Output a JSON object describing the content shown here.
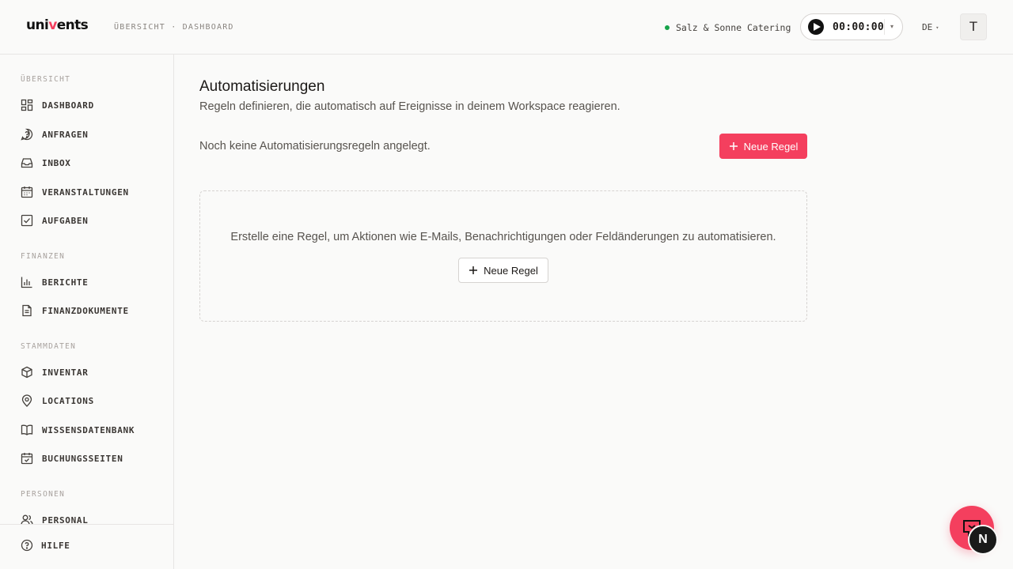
{
  "header": {
    "logo_prefix": "uni",
    "logo_accent": "v",
    "logo_suffix": "ents",
    "breadcrumb": "ÜBERSICHT · DASHBOARD",
    "workspace_name": "Salz & Sonne Catering",
    "timer": "00:00:00",
    "language": "DE",
    "avatar_initial": "T"
  },
  "sidebar": {
    "sections": [
      {
        "label": "ÜBERSICHT",
        "items": [
          {
            "label": "DASHBOARD",
            "icon": "dashboard-icon"
          },
          {
            "label": "ANFRAGEN",
            "icon": "question-icon"
          },
          {
            "label": "INBOX",
            "icon": "inbox-icon"
          },
          {
            "label": "VERANSTALTUNGEN",
            "icon": "calendar-icon"
          },
          {
            "label": "AUFGABEN",
            "icon": "checkbox-icon"
          }
        ]
      },
      {
        "label": "FINANZEN",
        "items": [
          {
            "label": "BERICHTE",
            "icon": "bar-chart-icon"
          },
          {
            "label": "FINANZDOKUMENTE",
            "icon": "document-icon"
          }
        ]
      },
      {
        "label": "STAMMDATEN",
        "items": [
          {
            "label": "INVENTAR",
            "icon": "box-icon"
          },
          {
            "label": "LOCATIONS",
            "icon": "map-pin-icon"
          },
          {
            "label": "WISSENSDATENBANK",
            "icon": "book-icon"
          },
          {
            "label": "BUCHUNGSSEITEN",
            "icon": "calendar-check-icon"
          }
        ]
      },
      {
        "label": "PERSONEN",
        "items": [
          {
            "label": "PERSONAL",
            "icon": "users-icon"
          }
        ]
      }
    ],
    "help_label": "HILFE"
  },
  "main": {
    "title": "Automatisierungen",
    "subtitle": "Regeln definieren, die automatisch auf Ereignisse in deinem Workspace reagieren.",
    "empty_note": "Noch keine Automatisierungsregeln angelegt.",
    "new_rule_label": "Neue Regel",
    "empty_state_text": "Erstelle eine Regel, um Aktionen wie E-Mails, Benachrichtigungen oder Feldänderungen zu automatisieren.",
    "empty_state_button": "Neue Regel"
  },
  "floating": {
    "badge_letter": "N"
  },
  "colors": {
    "accent": "#f43f5e",
    "status_online": "#16a34a"
  }
}
